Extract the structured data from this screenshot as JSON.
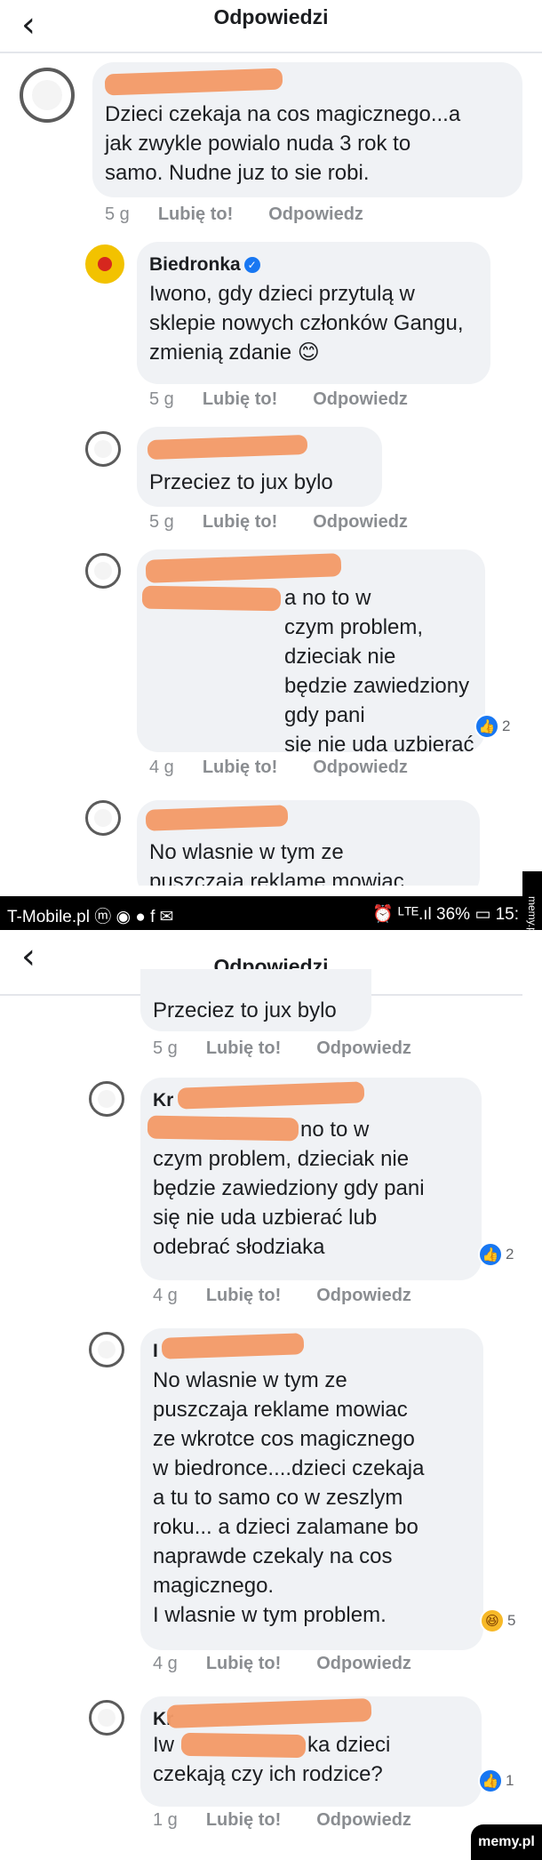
{
  "header_top": {
    "back_icon": "chevron-left-icon",
    "title": "Odpowiedzi"
  },
  "header_bottom": {
    "back_icon": "chevron-left-icon",
    "title": "Odpowiedzi"
  },
  "status_bar": {
    "carrier": "T-Mobile.pl",
    "left_icons": "ⓜ ◉ ● f ✉",
    "right_text": "⏰ ᴸᵀᴱ.ıl 36% ▭ 15:",
    "battery": "36%"
  },
  "watermark": {
    "side": "memy.pl",
    "corner": "memy.pl"
  },
  "actions": {
    "like": "Lubię to!",
    "reply": "Odpowiedz"
  },
  "comments_top": [
    {
      "name": "",
      "text": "Dzieci czekaja na cos magicznego...a\njak zwykle powialo nuda 3 rok to\nsamo. Nudne juz to sie robi.",
      "time": "5 g"
    },
    {
      "name": "Biedronka",
      "text": "Iwono, gdy dzieci przytulą w\nsklepie nowych członków Gangu,\nzmienią zdanie 😊",
      "time": "5 g"
    },
    {
      "name": "",
      "text": "Przeciez to jux bylo",
      "time": "5 g"
    },
    {
      "name": "",
      "text": "a no to w\nczym problem, dzieciak nie\nbędzie zawiedziony gdy pani\nsię nie uda uzbierać lub\nodebrać słodziaka",
      "time": "4 g",
      "reaction_count": "2"
    },
    {
      "name": "",
      "text": "No wlasnie w tym ze\npuszczaja reklame mowiac",
      "time": ""
    }
  ],
  "comments_bottom": [
    {
      "name": "",
      "text": "Przeciez to jux bylo",
      "time": "5 g"
    },
    {
      "name": "Kr",
      "text": "no to w\nczym problem, dzieciak nie\nbędzie zawiedziony gdy pani\nsię nie uda uzbierać lub\nodebrać słodziaka",
      "time": "4 g",
      "reaction_count": "2"
    },
    {
      "name": "I",
      "text": "No wlasnie w tym ze\npuszczaja reklame mowiac\nze wkrotce cos magicznego\nw biedronce....dzieci czekaja\na tu to samo co w zeszlym\nroku... a dzieci zalamane bo\nnaprawde czekaly na cos\nmagicznego.\nI wlasnie w tym problem.",
      "time": "4 g",
      "reaction_count": "5"
    },
    {
      "name": "Kr",
      "text": "ka dzieci\nczekają czy ich rodzice?",
      "text_prefix": "Iw",
      "time": "1 g",
      "reaction_count": "1"
    }
  ],
  "colors": {
    "bubble": "#f0f2f5",
    "redaction": "#f39a68",
    "like_blue": "#1877f2"
  }
}
